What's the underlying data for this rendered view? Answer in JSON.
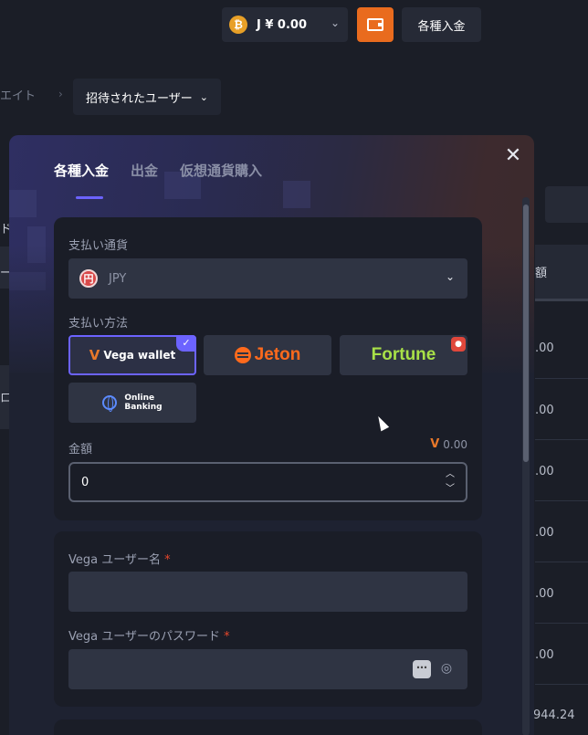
{
  "topbar": {
    "coin_symbol": "₿",
    "balance": "J ¥ 0.00",
    "deposit_label": "各種入金"
  },
  "breadcrumb": {
    "previous": "エイト",
    "separator": "›",
    "current": "招待されたユーザー"
  },
  "background": {
    "left_labels": [
      "ド",
      "ー",
      "ロ"
    ],
    "column_header": "額",
    "cells": [
      ".00",
      ".00",
      ".00",
      ".00",
      ".00",
      ".00"
    ],
    "total": "944.24"
  },
  "modal": {
    "tabs": [
      {
        "label": "各種入金",
        "active": true
      },
      {
        "label": "出金",
        "active": false
      },
      {
        "label": "仮想通貨購入",
        "active": false
      }
    ],
    "close_symbol": "✕",
    "currency": {
      "label": "支払い通貨",
      "icon_symbol": "円",
      "value": "JPY"
    },
    "payment_method": {
      "label": "支払い方法",
      "options": [
        {
          "name": "Vega wallet",
          "selected": true
        },
        {
          "name": "Jeton",
          "selected": false
        },
        {
          "name": "Fortune",
          "selected": false,
          "hot": true
        },
        {
          "name": "Online Banking",
          "line1": "Online",
          "line2": "Banking",
          "selected": false
        }
      ]
    },
    "amount": {
      "label": "金額",
      "balance": "0.00",
      "value": "0"
    },
    "vega_username": {
      "label": "Vega ユーザー名",
      "required_mark": "*"
    },
    "vega_password": {
      "label": "Vega ユーザーのパスワード",
      "required_mark": "*"
    }
  },
  "colors": {
    "accent": "#6c63ff",
    "wallet_button": "#e96b1e",
    "jeton": "#ff6a1c",
    "fortune": "#a8e048",
    "required": "#e8472b"
  }
}
